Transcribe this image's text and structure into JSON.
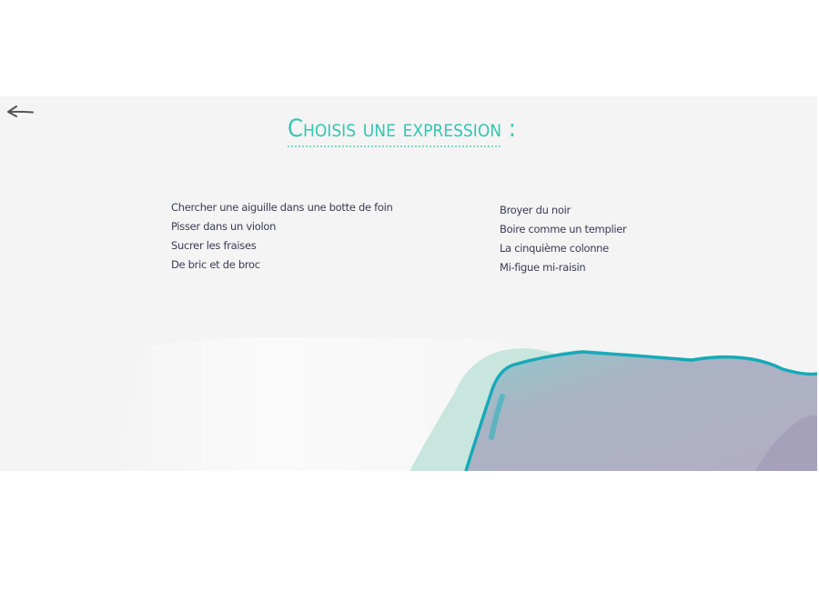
{
  "nav": {
    "back_icon": "arrow-left-icon"
  },
  "page": {
    "title": "Choisis une expression :"
  },
  "expressions": {
    "left": [
      "Chercher une aiguille dans une botte de foin",
      "Pisser dans un violon",
      "Sucrer les fraises",
      "De bric et de broc"
    ],
    "right": [
      "Broyer du noir",
      "Boire comme un templier",
      "La cinquième colonne",
      "Mi-figue mi-raisin"
    ]
  },
  "colors": {
    "accent": "#35c7b2",
    "text": "#3a3d55",
    "panel_background": "#f4f4f4",
    "watercolor_teal": "#1fb5c0",
    "watercolor_mint": "#bfe3d9",
    "watercolor_lilac": "#b2aec4"
  }
}
